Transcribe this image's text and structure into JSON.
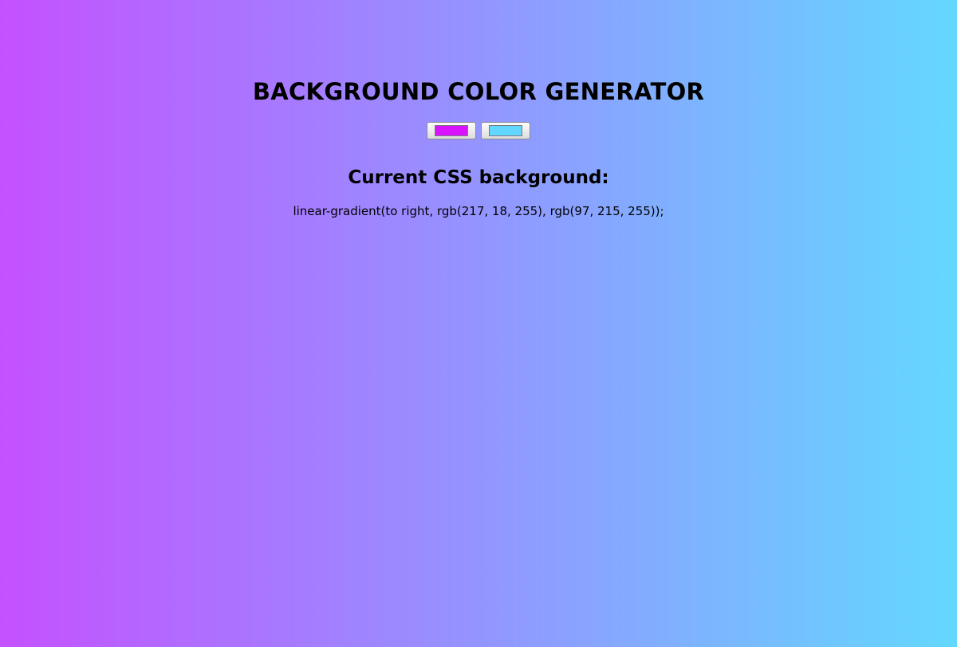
{
  "page": {
    "title": "BACKGROUND COLOR GENERATOR",
    "subtitle": "Current CSS background:",
    "css_value": "linear-gradient(to right, rgb(217, 18, 255), rgb(97, 215, 255));"
  },
  "colors": {
    "color1": "#d912ff",
    "color2": "#61d7ff",
    "gradient_start_rendered": "#c451ff",
    "gradient_end_rendered": "#63d8ff"
  }
}
